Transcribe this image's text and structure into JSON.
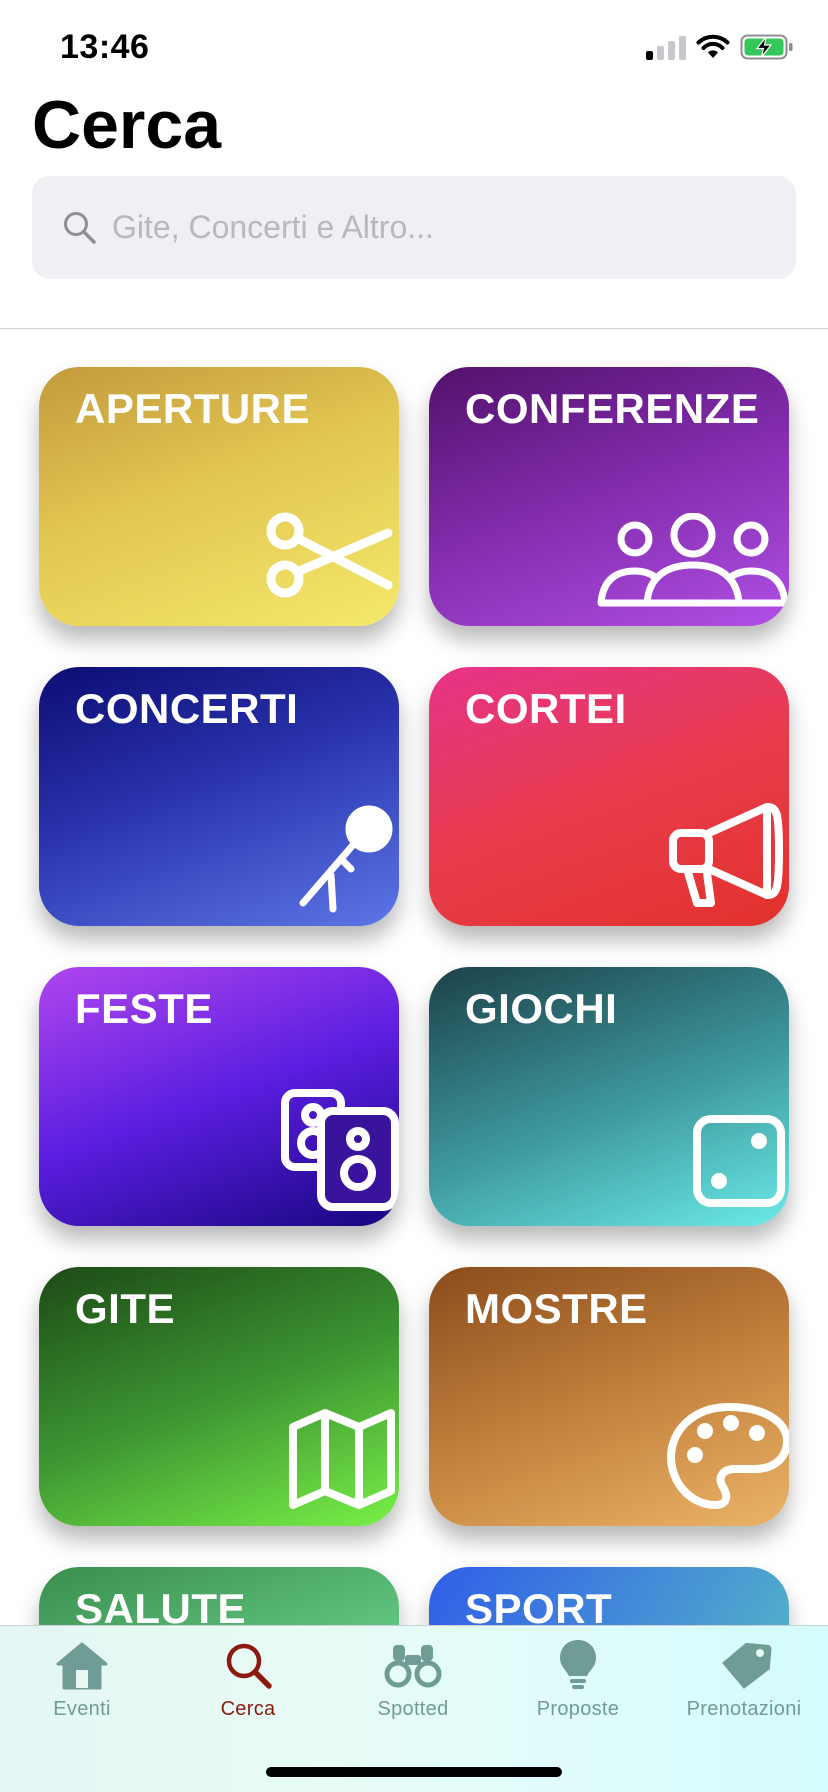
{
  "status_bar": {
    "time": "13:46",
    "signal_bars_active": 1,
    "battery_state": "charging"
  },
  "page": {
    "title": "Cerca"
  },
  "search": {
    "placeholder": "Gite, Concerti e Altro...",
    "icon": "search-icon"
  },
  "categories": [
    {
      "label": "APERTURE",
      "icon": "scissors-icon",
      "colors": [
        "#c39a3c",
        "#f4e96b"
      ]
    },
    {
      "label": "CONFERENZE",
      "icon": "people-group-icon",
      "colors": [
        "#52116b",
        "#b04fe6"
      ]
    },
    {
      "label": "CONCERTI",
      "icon": "microphone-icon",
      "colors": [
        "#0c0d73",
        "#5c76e6"
      ]
    },
    {
      "label": "CORTEI",
      "icon": "megaphone-icon",
      "colors": [
        "#e7338a",
        "#e2312c"
      ]
    },
    {
      "label": "FESTE",
      "icon": "speakers-icon",
      "colors": [
        "#b046ee",
        "#17067f"
      ]
    },
    {
      "label": "GIOCHI",
      "icon": "dice-icon",
      "colors": [
        "#1c4148",
        "#6ceae8"
      ]
    },
    {
      "label": "GITE",
      "icon": "map-icon",
      "colors": [
        "#1d4a16",
        "#79f047"
      ]
    },
    {
      "label": "MOSTRE",
      "icon": "palette-icon",
      "colors": [
        "#8b4c1c",
        "#eab468"
      ]
    },
    {
      "label": "SALUTE",
      "icon": "",
      "colors": [
        "#3a8e4e",
        "#86e3a6"
      ]
    },
    {
      "label": "SPORT",
      "icon": "",
      "colors": [
        "#2f5ee8",
        "#58c8c0"
      ]
    }
  ],
  "tab_bar": {
    "active_color": "#8d1a10",
    "inactive_color": "#6f9c94",
    "tabs": [
      {
        "label": "Eventi",
        "icon": "home-icon",
        "active": false
      },
      {
        "label": "Cerca",
        "icon": "search-icon",
        "active": true
      },
      {
        "label": "Spotted",
        "icon": "binoculars-icon",
        "active": false
      },
      {
        "label": "Proposte",
        "icon": "lightbulb-icon",
        "active": false
      },
      {
        "label": "Prenotazioni",
        "icon": "tag-icon",
        "active": false
      }
    ]
  }
}
